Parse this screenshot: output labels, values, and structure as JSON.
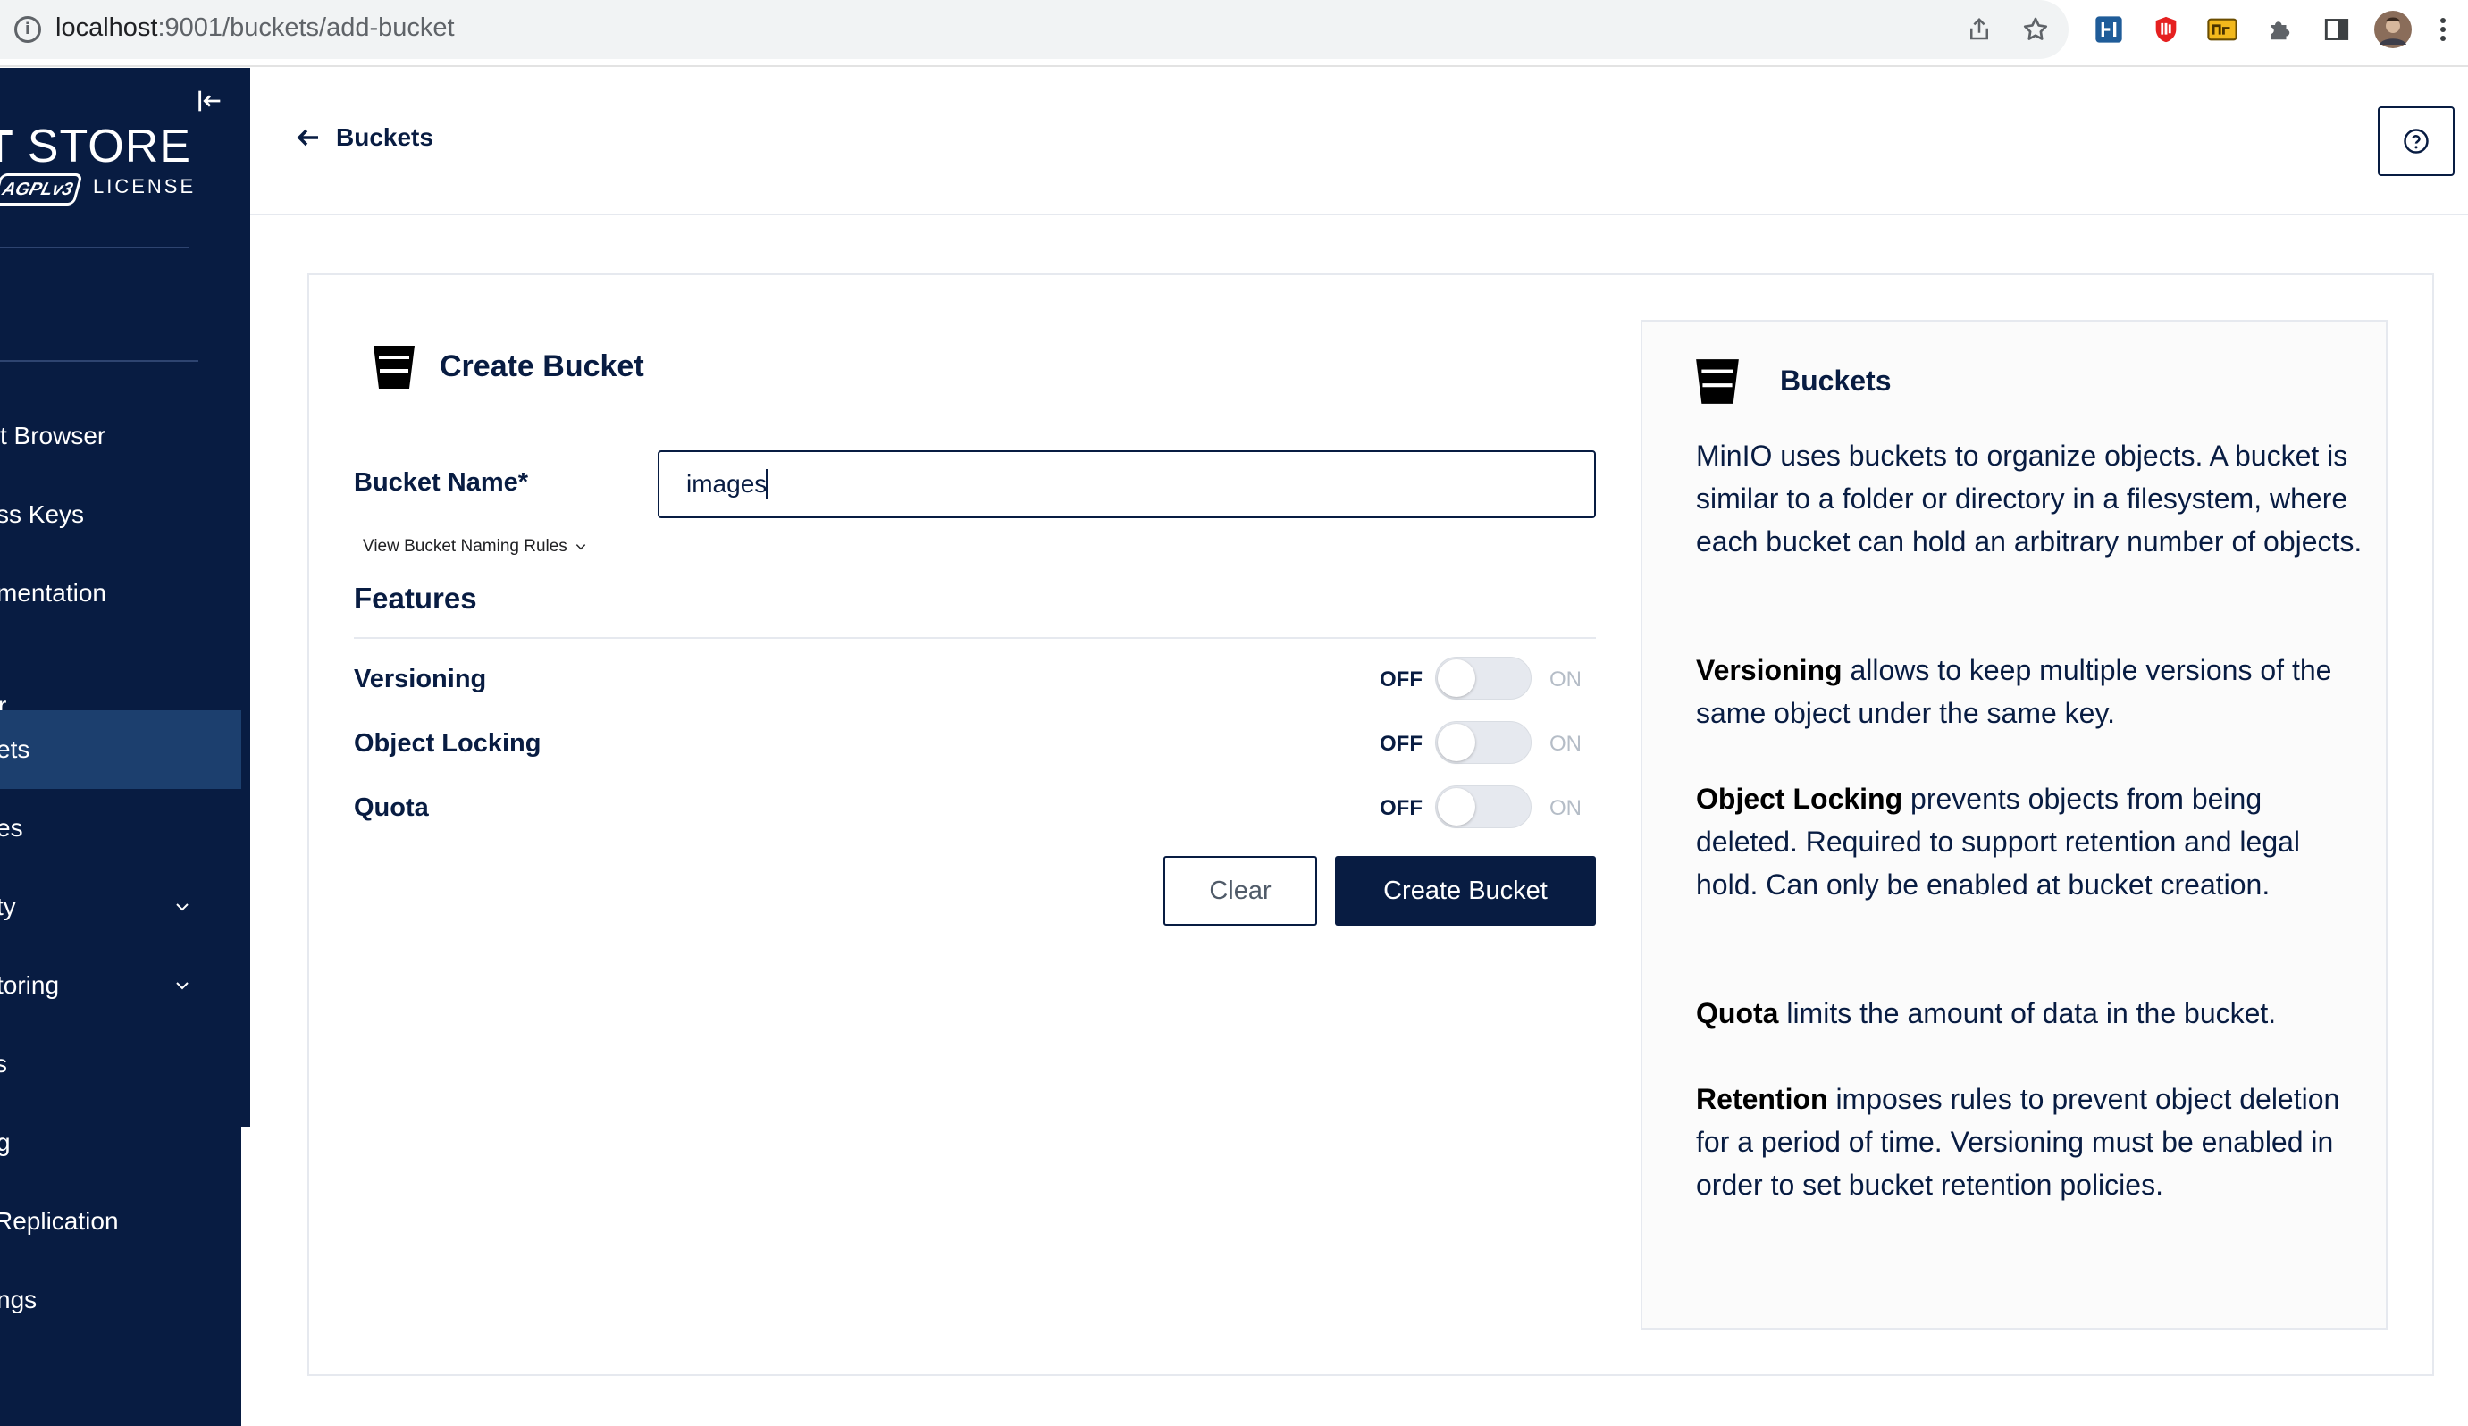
{
  "browser": {
    "url_host": "localhost",
    "url_rest": ":9001/buckets/add-bucket"
  },
  "sidebar": {
    "logo_text_bold": "CT",
    "logo_text": "STORE",
    "logo_badge": "AGPLv3",
    "license_label": "LICENSE",
    "items": [
      {
        "label": "ct Browser"
      },
      {
        "label": "ss Keys"
      },
      {
        "label": "mentation"
      },
      {
        "label": "r"
      },
      {
        "label": "ets",
        "active": true
      },
      {
        "label": "es"
      },
      {
        "label": "ty",
        "expandable": true
      },
      {
        "label": "toring",
        "expandable": true
      },
      {
        "label": "s"
      },
      {
        "label": "g"
      },
      {
        "label": "Replication"
      },
      {
        "label": "ngs"
      }
    ]
  },
  "header": {
    "back_label": "Buckets"
  },
  "form": {
    "title": "Create Bucket",
    "bucket_name_label": "Bucket Name*",
    "bucket_name_value": "images",
    "naming_rules_link": "View Bucket Naming Rules",
    "features_title": "Features",
    "features": [
      {
        "label": "Versioning",
        "off_label": "OFF",
        "on_label": "ON",
        "enabled": false
      },
      {
        "label": "Object Locking",
        "off_label": "OFF",
        "on_label": "ON",
        "enabled": false
      },
      {
        "label": "Quota",
        "off_label": "OFF",
        "on_label": "ON",
        "enabled": false
      }
    ],
    "clear_label": "Clear",
    "create_label": "Create Bucket"
  },
  "help": {
    "title": "Buckets",
    "intro": "MinIO uses buckets to organize objects. A bucket is similar to a folder or directory in a filesystem, where each bucket can hold an arbitrary number of objects.",
    "sections": [
      {
        "term": "Versioning",
        "text": " allows to keep multiple versions of the same object under the same key."
      },
      {
        "term": "Object Locking",
        "text": " prevents objects from being deleted. Required to support retention and legal hold. Can only be enabled at bucket creation."
      },
      {
        "term": "Quota",
        "text": " limits the amount of data in the bucket."
      },
      {
        "term": "Retention",
        "text": " imposes rules to prevent object deletion for a period of time. Versioning must be enabled in order to set bucket retention policies."
      }
    ]
  },
  "colors": {
    "brand_dark": "#081c42",
    "sidebar_active": "#1c3f6e",
    "switch_off": "#e6e9ef"
  },
  "icons": [
    "info-icon",
    "share-icon",
    "star-icon",
    "extension-icon",
    "puzzle-icon",
    "side-panel-icon",
    "profile-avatar",
    "menu-dots-icon",
    "collapse-sidebar-icon",
    "back-arrow-icon",
    "help-icon",
    "bucket-icon",
    "chevron-down-icon"
  ]
}
